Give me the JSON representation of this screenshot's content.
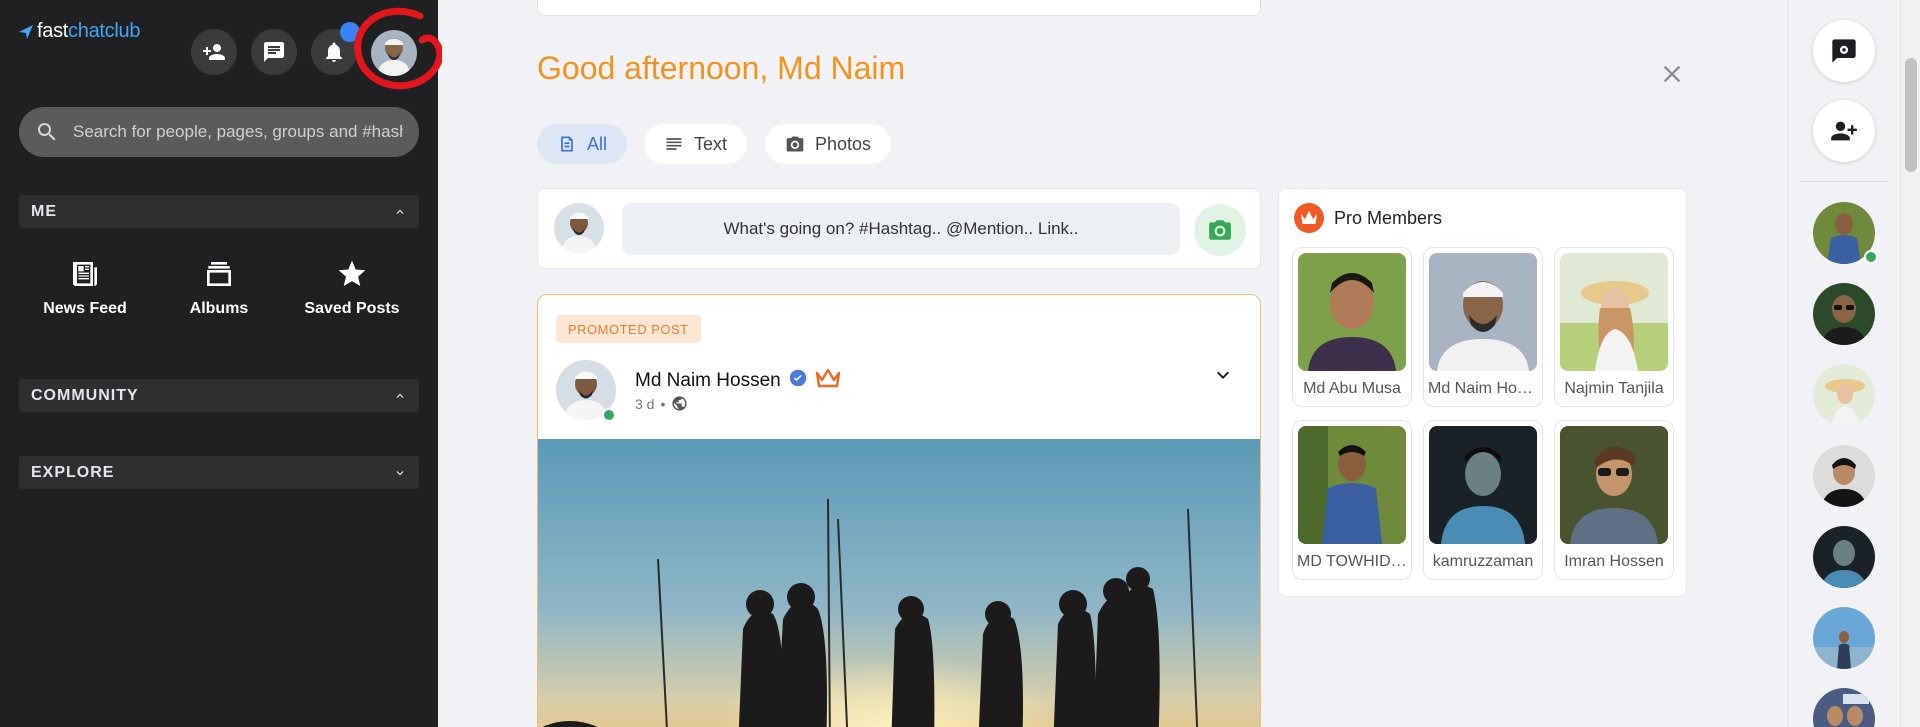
{
  "brand": {
    "name_part1": "fast",
    "name_part2": "chatclub",
    "accent": "#42a5f5"
  },
  "header": {
    "icons": [
      "add-friend-icon",
      "messages-icon",
      "notifications-icon"
    ],
    "search_placeholder": "Search for people, pages, groups and #hashtags"
  },
  "sidebar": {
    "sections": [
      {
        "label": "ME",
        "state": "expanded"
      },
      {
        "label": "COMMUNITY",
        "state": "expanded"
      },
      {
        "label": "EXPLORE",
        "state": "collapsed"
      }
    ],
    "me_items": [
      {
        "label": "News Feed",
        "icon": "newspaper-icon"
      },
      {
        "label": "Albums",
        "icon": "albums-icon"
      },
      {
        "label": "Saved Posts",
        "icon": "star-icon"
      }
    ]
  },
  "main": {
    "greeting": "Good afternoon, Md Naim",
    "greeting_color": "#f5921e",
    "filters": [
      {
        "label": "All",
        "active": true
      },
      {
        "label": "Text",
        "active": false
      },
      {
        "label": "Photos",
        "active": false
      }
    ],
    "composer_prompt": "What's going on? #Hashtag.. @Mention.. Link..",
    "post": {
      "badge": "PROMOTED POST",
      "author": "Md Naim Hossen",
      "time": "3 d",
      "separator": "•",
      "privacy_icon": "globe-icon"
    }
  },
  "pro_members": {
    "title": "Pro Members",
    "members": [
      {
        "name": "Md Abu Musa"
      },
      {
        "name": "Md Naim Hossen"
      },
      {
        "name": "Najmin Tanjila"
      },
      {
        "name": "MD TOWHIDUL"
      },
      {
        "name": "kamruzzaman"
      },
      {
        "name": "Imran Hossen"
      }
    ]
  },
  "right_rail": {
    "buttons": [
      "chat-settings-icon",
      "add-people-icon"
    ],
    "contacts_count": 7
  }
}
